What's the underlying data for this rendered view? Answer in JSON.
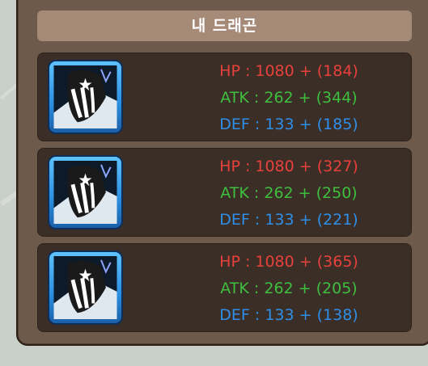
{
  "panel": {
    "title": "내 드래곤"
  },
  "dragons": [
    {
      "hp": "HP : 1080 + (184)",
      "atk": "ATK : 262 + (344)",
      "def": "DEF : 133 + (185)"
    },
    {
      "hp": "HP : 1080 + (327)",
      "atk": "ATK : 262 + (250)",
      "def": "DEF : 133 + (221)"
    },
    {
      "hp": "HP : 1080 + (365)",
      "atk": "ATK : 262 + (205)",
      "def": "DEF : 133 + (138)"
    }
  ],
  "colors": {
    "hp": "#e8413c",
    "atk": "#3fbf3f",
    "def": "#2f8fe8",
    "panel": "#6e5a4a",
    "title_bar": "#a58a77",
    "card": "#3a2e26"
  },
  "icons": {
    "portrait": "dark-dragon-portrait-icon"
  }
}
